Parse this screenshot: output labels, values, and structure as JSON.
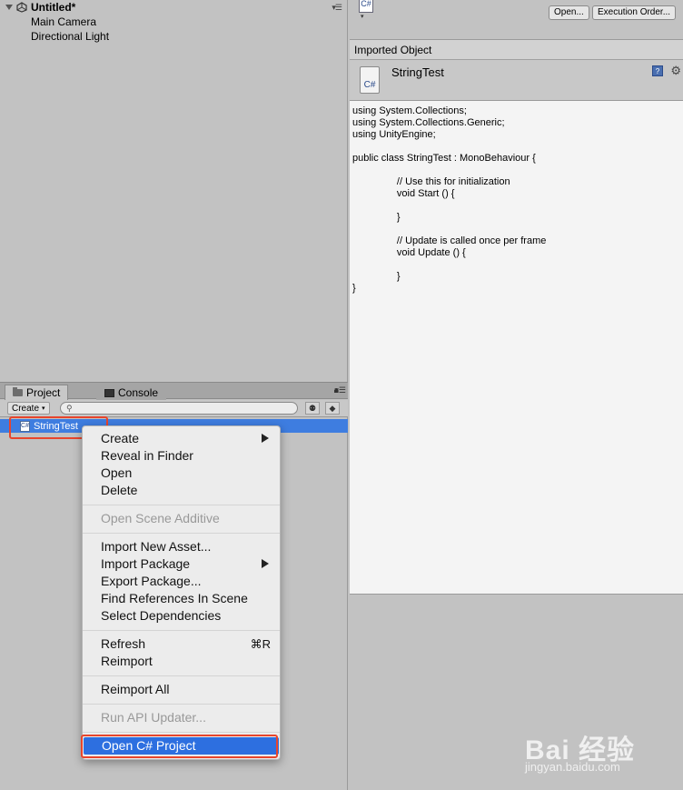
{
  "hierarchy": {
    "scene_name": "Untitled*",
    "items": [
      "Main Camera",
      "Directional Light"
    ]
  },
  "tabs": {
    "project": "Project",
    "console": "Console"
  },
  "toolbar": {
    "create_label": "Create"
  },
  "project": {
    "selected_file": "StringTest"
  },
  "context_menu": {
    "groups": [
      [
        "Create",
        "Reveal in Finder",
        "Open",
        "Delete"
      ],
      [
        "Open Scene Additive"
      ],
      [
        "Import New Asset...",
        "Import Package",
        "Export Package...",
        "Find References In Scene",
        "Select Dependencies"
      ],
      [
        "Refresh",
        "Reimport"
      ],
      [
        "Reimport All"
      ],
      [
        "Run API Updater..."
      ],
      [
        "Open C# Project"
      ]
    ],
    "create": "Create",
    "reveal": "Reveal in Finder",
    "open": "Open",
    "delete": "Delete",
    "open_scene_additive": "Open Scene Additive",
    "import_new_asset": "Import New Asset...",
    "import_package": "Import Package",
    "export_package": "Export Package...",
    "find_references": "Find References In Scene",
    "select_dependencies": "Select Dependencies",
    "refresh": "Refresh",
    "refresh_shortcut": "⌘R",
    "reimport": "Reimport",
    "reimport_all": "Reimport All",
    "run_api_updater": "Run API Updater...",
    "open_csharp_project": "Open C# Project",
    "disabled_items": [
      "Open Scene Additive",
      "Run API Updater..."
    ],
    "highlighted_item": "Open C# Project"
  },
  "inspector": {
    "open_button": "Open...",
    "execution_order_button": "Execution Order...",
    "imported_object_header": "Imported Object",
    "file_name": "StringTest",
    "cs_label": "C#",
    "code_lines": [
      "using System.Collections;",
      "using System.Collections.Generic;",
      "using UnityEngine;",
      "",
      "public class StringTest : MonoBehaviour {",
      "",
      "\t\t// Use this for initialization",
      "\t\tvoid Start () {",
      "",
      "\t\t}",
      "",
      "\t\t// Update is called once per frame",
      "\t\tvoid Update () {",
      "",
      "\t\t}",
      "}"
    ]
  },
  "watermark": {
    "main": "Bai 经验",
    "sub": "jingyan.baidu.com"
  },
  "colors": {
    "selection_blue": "#3e7de0",
    "menu_highlight": "#2d6fe0",
    "annotation_red": "#e8452c"
  }
}
